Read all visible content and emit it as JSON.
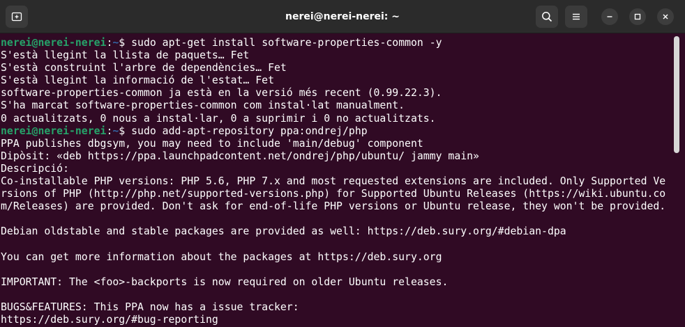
{
  "window": {
    "title": "nerei@nerei-nerei: ~",
    "buttons": {
      "new_tab": "new-tab-icon",
      "search": "search-icon",
      "menu": "hamburger-menu-icon",
      "minimize": "minimize-icon",
      "maximize": "maximize-icon",
      "close": "close-icon"
    }
  },
  "colors": {
    "background": "#300a24",
    "prompt_user": "#26a269",
    "prompt_path": "#3465a4",
    "text": "#ffffff"
  },
  "terminal": {
    "prompt1": {
      "user": "nerei@nerei-nerei",
      "sep": ":",
      "path": "~",
      "symbol": "$",
      "command": " sudo apt-get install software-properties-common -y"
    },
    "out1": [
      "S'està llegint la llista de paquets… Fet",
      "S'està construint l'arbre de dependències… Fet",
      "S'està llegint la informació de l'estat… Fet",
      "software-properties-common ja està en la versió més recent (0.99.22.3).",
      "S'ha marcat software-properties-common com instal·lat manualment.",
      "0 actualitzats, 0 nous a instal·lar, 0 a suprimir i 0 no actualitzats."
    ],
    "prompt2": {
      "user": "nerei@nerei-nerei",
      "sep": ":",
      "path": "~",
      "symbol": "$",
      "command": " sudo add-apt-repository ppa:ondrej/php"
    },
    "out2": [
      "PPA publishes dbgsym, you may need to include 'main/debug' component",
      "Dipòsit: «deb https://ppa.launchpadcontent.net/ondrej/php/ubuntu/ jammy main»",
      "Descripció:",
      "Co-installable PHP versions: PHP 5.6, PHP 7.x and most requested extensions are included. Only Supported Ve",
      "rsions of PHP (http://php.net/supported-versions.php) for Supported Ubuntu Releases (https://wiki.ubuntu.co",
      "m/Releases) are provided. Don't ask for end-of-life PHP versions or Ubuntu release, they won't be provided.",
      "",
      "Debian oldstable and stable packages are provided as well: https://deb.sury.org/#debian-dpa",
      "",
      "You can get more information about the packages at https://deb.sury.org",
      "",
      "IMPORTANT: The <foo>-backports is now required on older Ubuntu releases.",
      "",
      "BUGS&FEATURES: This PPA now has a issue tracker:",
      "https://deb.sury.org/#bug-reporting"
    ]
  }
}
